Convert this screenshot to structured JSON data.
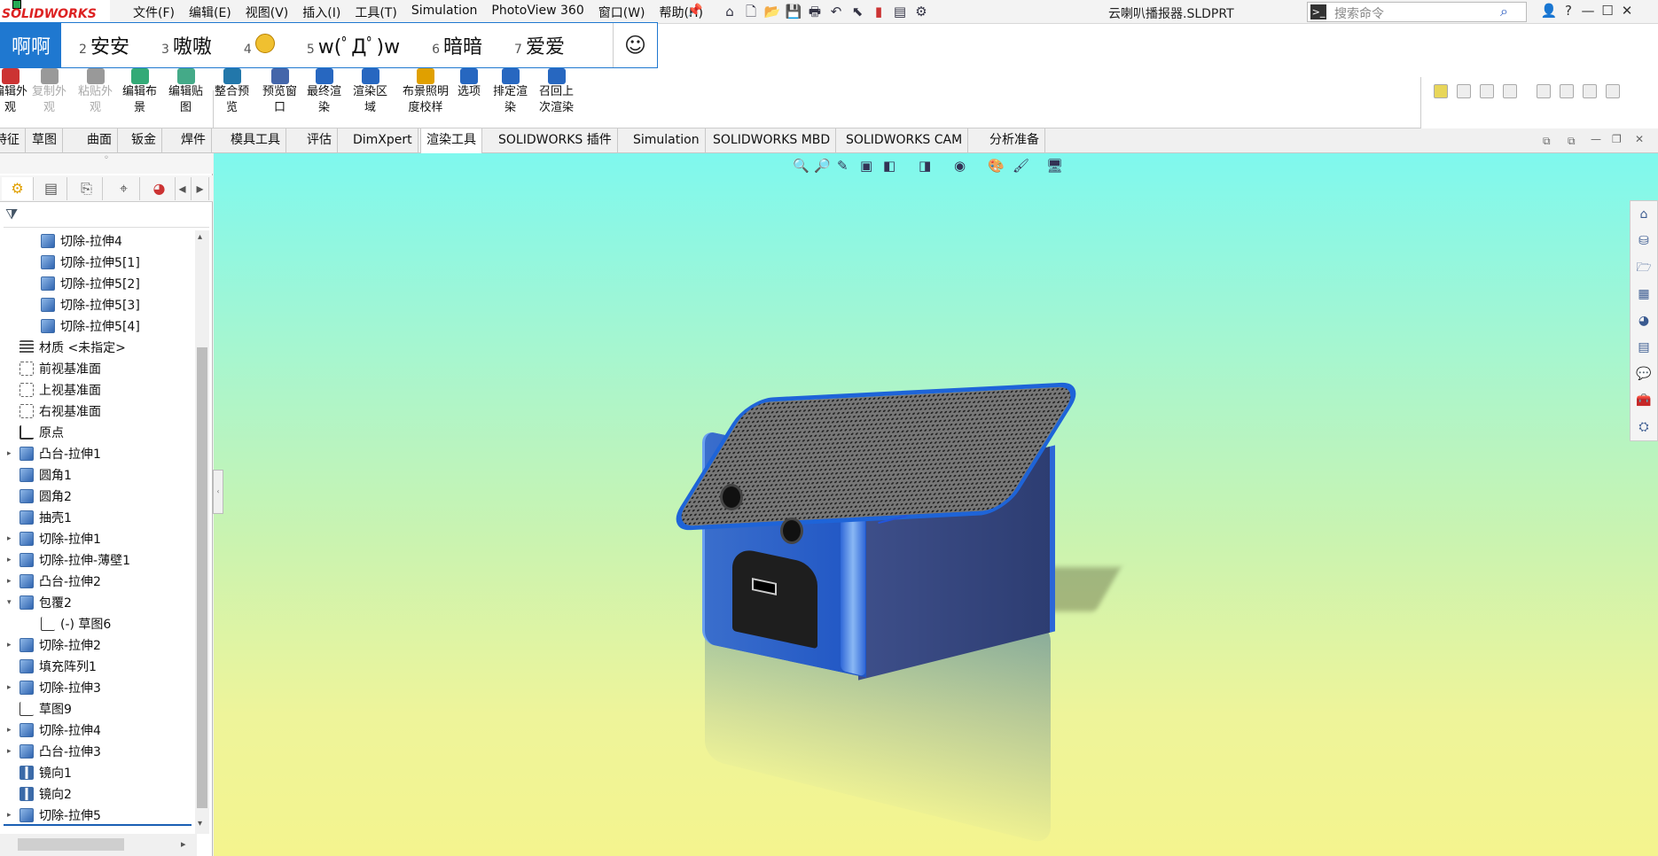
{
  "app": {
    "logo_text": "SOLIDWORKS",
    "file_title": "云喇叭播报器.SLDPRT"
  },
  "menu": [
    "文件(F)",
    "编辑(E)",
    "视图(V)",
    "插入(I)",
    "工具(T)",
    "Simulation",
    "PhotoView 360",
    "窗口(W)",
    "帮助(H)"
  ],
  "search": {
    "placeholder": "搜索命令"
  },
  "ime": {
    "selected": "啊啊",
    "candidates": [
      {
        "n": "2",
        "text": "安安"
      },
      {
        "n": "3",
        "text": "嗷嗷"
      },
      {
        "n": "4",
        "text": ""
      },
      {
        "n": "5",
        "text": "w(ﾟДﾟ)w"
      },
      {
        "n": "6",
        "text": "暗暗"
      },
      {
        "n": "7",
        "text": "爱爱"
      }
    ],
    "smile": "☺"
  },
  "ribbon": {
    "buttons": [
      {
        "l1": "编辑外",
        "l2": "观",
        "disabled": false
      },
      {
        "l1": "复制外",
        "l2": "观",
        "disabled": true
      },
      {
        "l1": "粘贴外",
        "l2": "观",
        "disabled": true
      },
      {
        "l1": "编辑布",
        "l2": "景",
        "disabled": false
      },
      {
        "l1": "编辑贴",
        "l2": "图",
        "disabled": false
      },
      {
        "l1": "整合预",
        "l2": "览",
        "disabled": false
      },
      {
        "l1": "预览窗",
        "l2": "口",
        "disabled": false
      },
      {
        "l1": "最终渲",
        "l2": "染",
        "disabled": false
      },
      {
        "l1": "渲染区",
        "l2": "域",
        "disabled": false
      },
      {
        "l1": "布景照明",
        "l2": "度校样",
        "disabled": false
      },
      {
        "l1": "选项",
        "l2": "",
        "disabled": false
      },
      {
        "l1": "排定渲",
        "l2": "染",
        "disabled": false
      },
      {
        "l1": "召回上",
        "l2": "次渲染",
        "disabled": false
      }
    ]
  },
  "tabs": [
    {
      "label": "特征",
      "active": false
    },
    {
      "label": "草图",
      "active": false
    },
    {
      "label": "曲面",
      "active": false
    },
    {
      "label": "钣金",
      "active": false
    },
    {
      "label": "焊件",
      "active": false
    },
    {
      "label": "模具工具",
      "active": false
    },
    {
      "label": "评估",
      "active": false
    },
    {
      "label": "DimXpert",
      "active": false
    },
    {
      "label": "渲染工具",
      "active": true
    },
    {
      "label": "SOLIDWORKS 插件",
      "active": false
    },
    {
      "label": "Simulation",
      "active": false
    },
    {
      "label": "SOLIDWORKS MBD",
      "active": false
    },
    {
      "label": "SOLIDWORKS CAM",
      "active": false
    },
    {
      "label": "分析准备",
      "active": false
    }
  ],
  "tree": [
    {
      "label": "切除-拉伸4",
      "indent": 1,
      "arrow": "",
      "icon": "feat"
    },
    {
      "label": "切除-拉伸5[1]",
      "indent": 1,
      "arrow": "",
      "icon": "feat"
    },
    {
      "label": "切除-拉伸5[2]",
      "indent": 1,
      "arrow": "",
      "icon": "feat"
    },
    {
      "label": "切除-拉伸5[3]",
      "indent": 1,
      "arrow": "",
      "icon": "feat"
    },
    {
      "label": "切除-拉伸5[4]",
      "indent": 1,
      "arrow": "",
      "icon": "feat"
    },
    {
      "label": "材质 <未指定>",
      "indent": 0,
      "arrow": "",
      "icon": "mat"
    },
    {
      "label": "前视基准面",
      "indent": 0,
      "arrow": "",
      "icon": "pl"
    },
    {
      "label": "上视基准面",
      "indent": 0,
      "arrow": "",
      "icon": "pl"
    },
    {
      "label": "右视基准面",
      "indent": 0,
      "arrow": "",
      "icon": "pl"
    },
    {
      "label": "原点",
      "indent": 0,
      "arrow": "",
      "icon": "org"
    },
    {
      "label": "凸台-拉伸1",
      "indent": 0,
      "arrow": "▸",
      "icon": "feat"
    },
    {
      "label": "圆角1",
      "indent": 0,
      "arrow": "",
      "icon": "feat"
    },
    {
      "label": "圆角2",
      "indent": 0,
      "arrow": "",
      "icon": "feat"
    },
    {
      "label": "抽壳1",
      "indent": 0,
      "arrow": "",
      "icon": "feat"
    },
    {
      "label": "切除-拉伸1",
      "indent": 0,
      "arrow": "▸",
      "icon": "feat"
    },
    {
      "label": "切除-拉伸-薄壁1",
      "indent": 0,
      "arrow": "▸",
      "icon": "feat"
    },
    {
      "label": "凸台-拉伸2",
      "indent": 0,
      "arrow": "▸",
      "icon": "feat"
    },
    {
      "label": "包覆2",
      "indent": 0,
      "arrow": "▾",
      "icon": "feat"
    },
    {
      "label": "(-) 草图6",
      "indent": 1,
      "arrow": "",
      "icon": "sk"
    },
    {
      "label": "切除-拉伸2",
      "indent": 0,
      "arrow": "▸",
      "icon": "feat"
    },
    {
      "label": "填充阵列1",
      "indent": 0,
      "arrow": "",
      "icon": "feat"
    },
    {
      "label": "切除-拉伸3",
      "indent": 0,
      "arrow": "▸",
      "icon": "feat"
    },
    {
      "label": "草图9",
      "indent": 0,
      "arrow": "",
      "icon": "sk"
    },
    {
      "label": "切除-拉伸4",
      "indent": 0,
      "arrow": "▸",
      "icon": "feat"
    },
    {
      "label": "凸台-拉伸3",
      "indent": 0,
      "arrow": "▸",
      "icon": "feat"
    },
    {
      "label": "镜向1",
      "indent": 0,
      "arrow": "",
      "icon": "mir"
    },
    {
      "label": "镜向2",
      "indent": 0,
      "arrow": "",
      "icon": "mir"
    },
    {
      "label": "切除-拉伸5",
      "indent": 0,
      "arrow": "▸",
      "icon": "feat"
    }
  ]
}
